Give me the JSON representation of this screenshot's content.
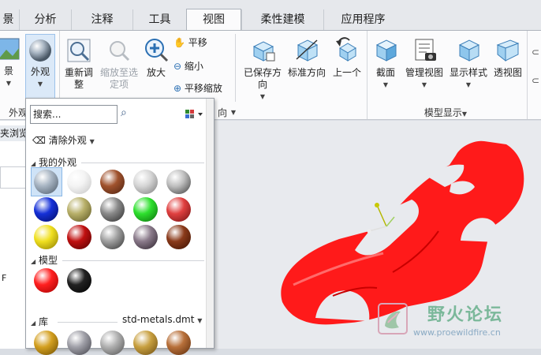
{
  "tabs": [
    {
      "label": "景",
      "active": false
    },
    {
      "label": "分析",
      "active": false
    },
    {
      "label": "注释",
      "active": false
    },
    {
      "label": "工具",
      "active": false
    },
    {
      "label": "视图",
      "active": true
    },
    {
      "label": "柔性建模",
      "active": false
    },
    {
      "label": "应用程序",
      "active": false
    }
  ],
  "ribbon": {
    "left_partial": "景",
    "appearance": "外观",
    "refit": "重新调整",
    "zoom_selected": "缩放至选定项",
    "zoom_in": "放大",
    "pan": "平移",
    "zoom_out": "缩小",
    "pan_zoom": "平移缩放",
    "saved_orient": "已保存方向",
    "std_orient": "标准方向",
    "prev": "上一个",
    "section": "截面",
    "manage_views": "管理视图",
    "display_style": "显示样式",
    "perspective": "透视图",
    "grp_appearance": "外观",
    "grp_orient_partial": "向",
    "grp_model_display": "模型显示"
  },
  "leftpane": {
    "text1": "夹浏览",
    "text2": "F"
  },
  "panel": {
    "search_placeholder": "搜索...",
    "clear_appearance": "清除外观",
    "my_appearances": "我的外观",
    "model": "模型",
    "library": "库",
    "library_file": "std-metals.dmt"
  },
  "watermark": {
    "name": "野火论坛",
    "url": "www.proewildfire.cn"
  },
  "colors": {
    "car": "#ff1a1a",
    "accent": "#2a7fd4"
  }
}
